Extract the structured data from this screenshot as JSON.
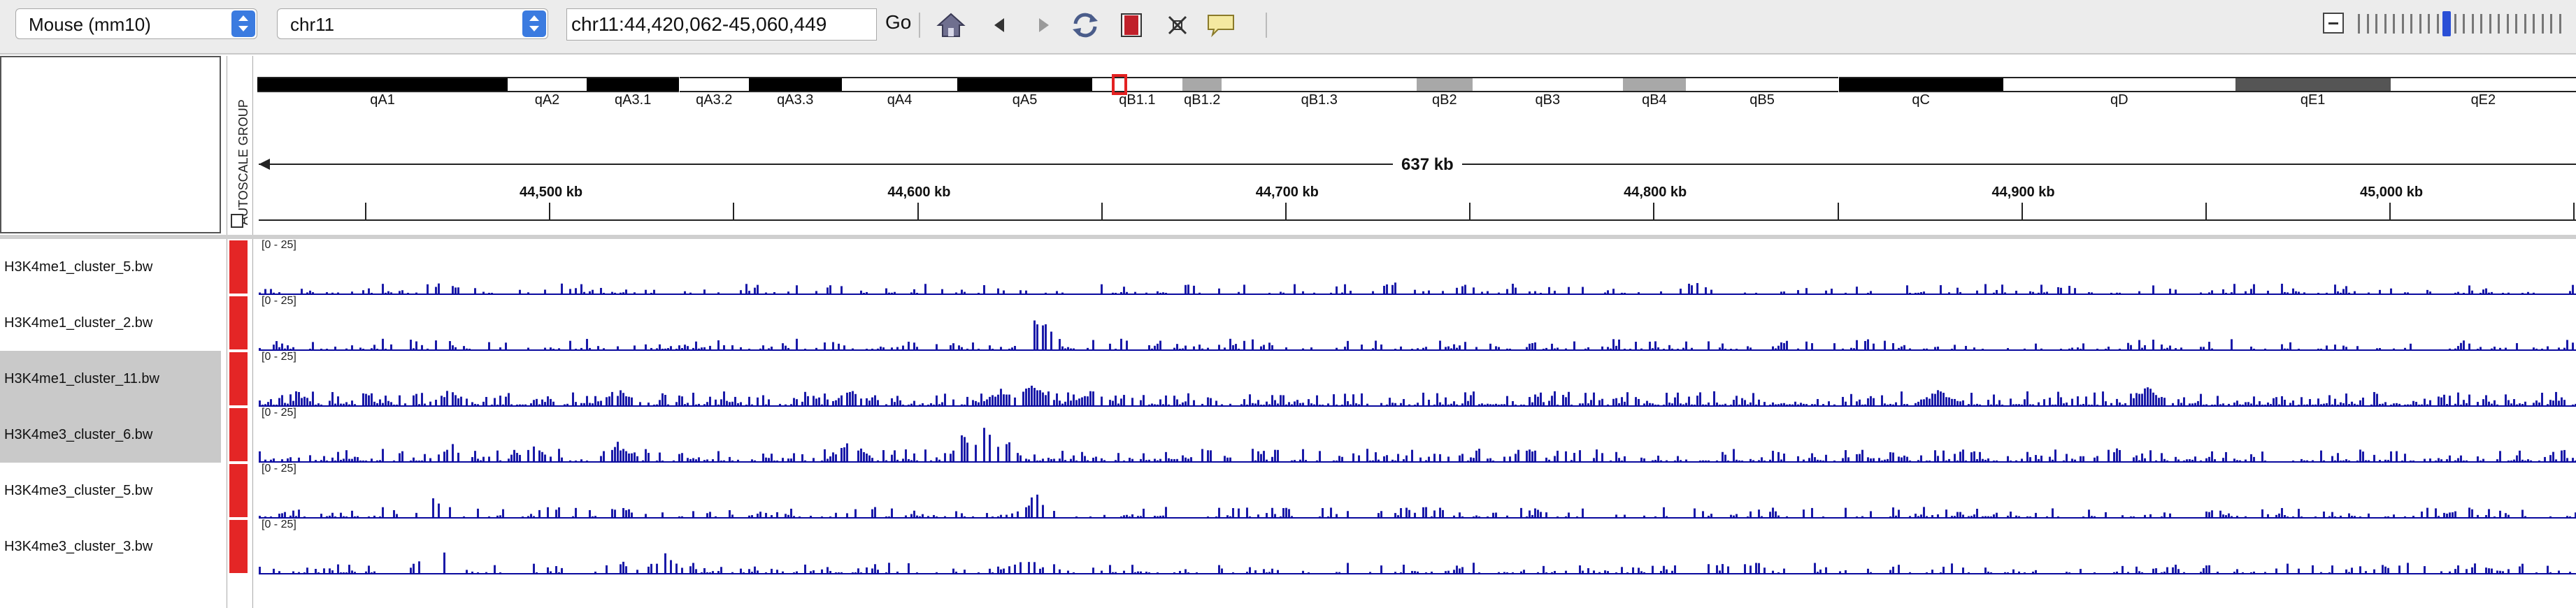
{
  "toolbar": {
    "genome": "Mouse (mm10)",
    "chromosome": "chr11",
    "locus": "chr11:44,420,062-45,060,449",
    "go_label": "Go",
    "icons": [
      "home-icon",
      "back-arrow-icon",
      "forward-arrow-icon",
      "refresh-icon",
      "region-of-interest-icon",
      "resize-icon",
      "popup-text-icon"
    ],
    "zoom": {
      "level_fraction": 0.42
    }
  },
  "autoscale_group_label": "AUTOSCALE GROUP",
  "ideogram": {
    "bands": [
      {
        "name": "qA1",
        "start": 0,
        "end": 0.108,
        "color": "#000000"
      },
      {
        "name": "qA2",
        "start": 0.108,
        "end": 0.142,
        "color": "#ffffff"
      },
      {
        "name": "qA3.1",
        "start": 0.142,
        "end": 0.182,
        "color": "#000000"
      },
      {
        "name": "qA3.2",
        "start": 0.182,
        "end": 0.212,
        "color": "#ffffff"
      },
      {
        "name": "qA3.3",
        "start": 0.212,
        "end": 0.252,
        "color": "#000000"
      },
      {
        "name": "qA4",
        "start": 0.252,
        "end": 0.302,
        "color": "#ffffff"
      },
      {
        "name": "qA5",
        "start": 0.302,
        "end": 0.36,
        "color": "#000000"
      },
      {
        "name": "qB1.1",
        "start": 0.36,
        "end": 0.399,
        "color": "#ffffff"
      },
      {
        "name": "qB1.2",
        "start": 0.399,
        "end": 0.416,
        "color": "#a8a8a8"
      },
      {
        "name": "qB1.3",
        "start": 0.416,
        "end": 0.5,
        "color": "#ffffff"
      },
      {
        "name": "qB2",
        "start": 0.5,
        "end": 0.524,
        "color": "#a8a8a8"
      },
      {
        "name": "qB3",
        "start": 0.524,
        "end": 0.589,
        "color": "#ffffff"
      },
      {
        "name": "qB4",
        "start": 0.589,
        "end": 0.616,
        "color": "#a8a8a8"
      },
      {
        "name": "qB5",
        "start": 0.616,
        "end": 0.682,
        "color": "#ffffff"
      },
      {
        "name": "qC",
        "start": 0.682,
        "end": 0.753,
        "color": "#000000"
      },
      {
        "name": "qD",
        "start": 0.753,
        "end": 0.853,
        "color": "#ffffff"
      },
      {
        "name": "qE1",
        "start": 0.853,
        "end": 0.92,
        "color": "#555555"
      },
      {
        "name": "qE2",
        "start": 0.92,
        "end": 1.0,
        "color": "#ffffff"
      }
    ]
  },
  "ruler": {
    "span_label": "637 kb",
    "ticks": [
      "44,500 kb",
      "44,600 kb",
      "44,700 kb",
      "44,800 kb",
      "44,900 kb",
      "45,000 kb"
    ]
  },
  "tracks": [
    {
      "name": "H3K4me1_cluster_5.bw",
      "range": "[0 - 25]",
      "selected": false,
      "seed": 11,
      "density": 0.33,
      "peaks": [
        [
          0.08,
          0.35
        ],
        [
          0.13,
          0.3
        ],
        [
          0.49,
          0.35
        ],
        [
          0.57,
          0.3
        ],
        [
          0.62,
          0.28
        ],
        [
          0.67,
          0.25
        ],
        [
          0.78,
          0.25
        ]
      ]
    },
    {
      "name": "H3K4me1_cluster_2.bw",
      "range": "[0 - 25]",
      "selected": false,
      "seed": 23,
      "density": 0.42,
      "peaks": [
        [
          0.336,
          0.95
        ],
        [
          0.16,
          0.2
        ],
        [
          0.2,
          0.18
        ],
        [
          0.29,
          0.2
        ]
      ]
    },
    {
      "name": "H3K4me1_cluster_11.bw",
      "range": "[0 - 25]",
      "selected": true,
      "seed": 37,
      "density": 0.78,
      "peaks": [
        [
          0.082,
          0.45
        ],
        [
          0.155,
          0.45
        ],
        [
          0.255,
          0.45
        ],
        [
          0.32,
          0.5
        ],
        [
          0.335,
          0.7
        ],
        [
          0.36,
          0.38
        ],
        [
          0.725,
          0.45
        ],
        [
          0.815,
          0.5
        ]
      ]
    },
    {
      "name": "H3K4me3_cluster_6.bw",
      "range": "[0 - 25]",
      "selected": true,
      "seed": 51,
      "density": 0.62,
      "peaks": [
        [
          0.083,
          0.45
        ],
        [
          0.117,
          0.45
        ],
        [
          0.154,
          0.55
        ],
        [
          0.255,
          0.62
        ],
        [
          0.305,
          0.8
        ],
        [
          0.312,
          0.95
        ],
        [
          0.32,
          0.7
        ],
        [
          0.41,
          0.4
        ],
        [
          0.546,
          0.45
        ],
        [
          0.8,
          0.42
        ]
      ]
    },
    {
      "name": "H3K4me3_cluster_5.bw",
      "range": "[0 - 25]",
      "selected": false,
      "seed": 67,
      "density": 0.38,
      "peaks": [
        [
          0.076,
          0.55
        ],
        [
          0.155,
          0.35
        ],
        [
          0.335,
          0.65
        ],
        [
          0.84,
          0.25
        ],
        [
          0.95,
          0.25
        ]
      ]
    },
    {
      "name": "H3K4me3_cluster_3.bw",
      "range": "[0 - 25]",
      "selected": false,
      "seed": 83,
      "density": 0.4,
      "peaks": [
        [
          0.075,
          0.9
        ],
        [
          0.08,
          0.55
        ],
        [
          0.155,
          0.4
        ],
        [
          0.175,
          0.55
        ],
        [
          0.33,
          0.45
        ],
        [
          0.64,
          0.4
        ],
        [
          0.925,
          0.35
        ],
        [
          0.958,
          0.3
        ]
      ]
    }
  ],
  "colors": {
    "track_bar": "#1a1aa8",
    "attribute": "#e42626",
    "selection": "#c9c9c9"
  }
}
